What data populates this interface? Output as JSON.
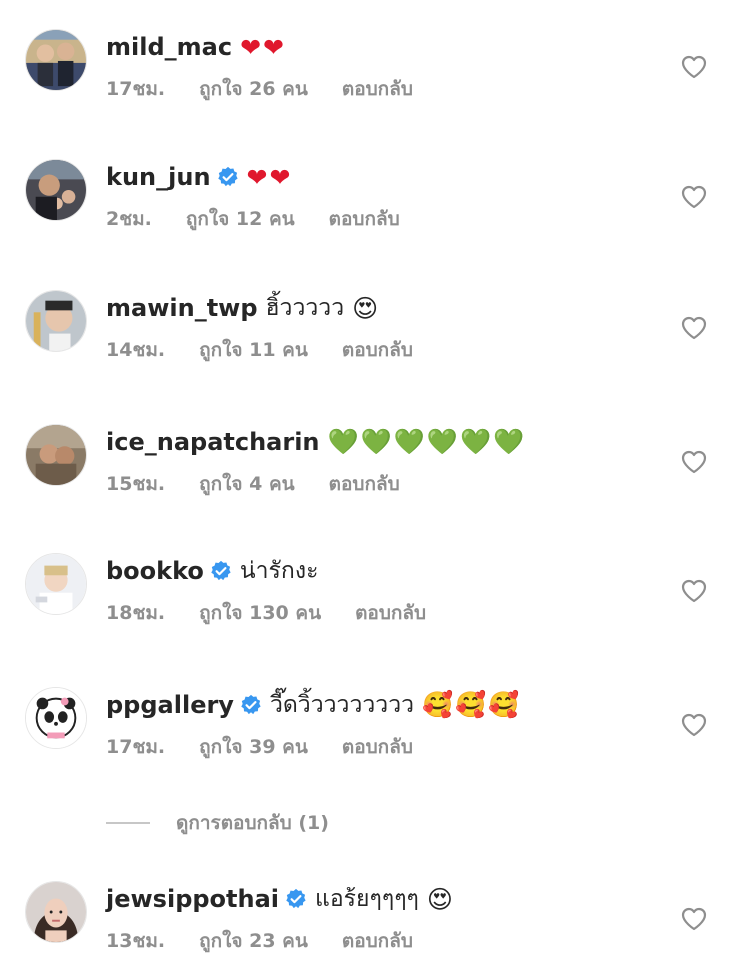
{
  "colors": {
    "text": "#262626",
    "meta": "#8e8e8e",
    "verified": "#3897f0"
  },
  "comments": [
    {
      "username": "mild_mac",
      "verified": false,
      "text": "",
      "emoji": "❤❤",
      "emoji_name": "red-heart-emoji",
      "time": "17ชม.",
      "likes": "ถูกใจ 26 คน",
      "reply": "ตอบกลับ"
    },
    {
      "username": "kun_jun",
      "verified": true,
      "text": "",
      "emoji": "❤❤",
      "emoji_name": "red-heart-emoji",
      "time": "2ชม.",
      "likes": "ถูกใจ 12 คน",
      "reply": "ตอบกลับ"
    },
    {
      "username": "mawin_twp",
      "verified": false,
      "text": "ฮิ้ววววว",
      "emoji": "😍",
      "emoji_name": "heart-eyes-emoji",
      "time": "14ชม.",
      "likes": "ถูกใจ 11 คน",
      "reply": "ตอบกลับ"
    },
    {
      "username": "ice_napatcharin",
      "verified": false,
      "text": "",
      "emoji": "💚💚💚💚💚💚",
      "emoji_name": "green-heart-emoji",
      "time": "15ชม.",
      "likes": "ถูกใจ 4 คน",
      "reply": "ตอบกลับ"
    },
    {
      "username": "bookko",
      "verified": true,
      "text": "น่ารักงะ",
      "emoji": "",
      "emoji_name": "",
      "time": "18ชม.",
      "likes": "ถูกใจ 130 คน",
      "reply": "ตอบกลับ"
    },
    {
      "username": "ppgallery",
      "verified": true,
      "text": "วี๊ดวิ้วววววววว",
      "emoji": "🥰🥰🥰",
      "emoji_name": "smiling-hearts-emoji",
      "time": "17ชม.",
      "likes": "ถูกใจ 39 คน",
      "reply": "ตอบกลับ"
    },
    {
      "username": "jewsippothai",
      "verified": true,
      "text": "แอร้ยๆๆๆๆ",
      "emoji": "😍",
      "emoji_name": "heart-eyes-emoji",
      "time": "13ชม.",
      "likes": "ถูกใจ 23 คน",
      "reply": "ตอบกลับ"
    }
  ],
  "view_replies": "ดูการตอบกลับ (1)"
}
